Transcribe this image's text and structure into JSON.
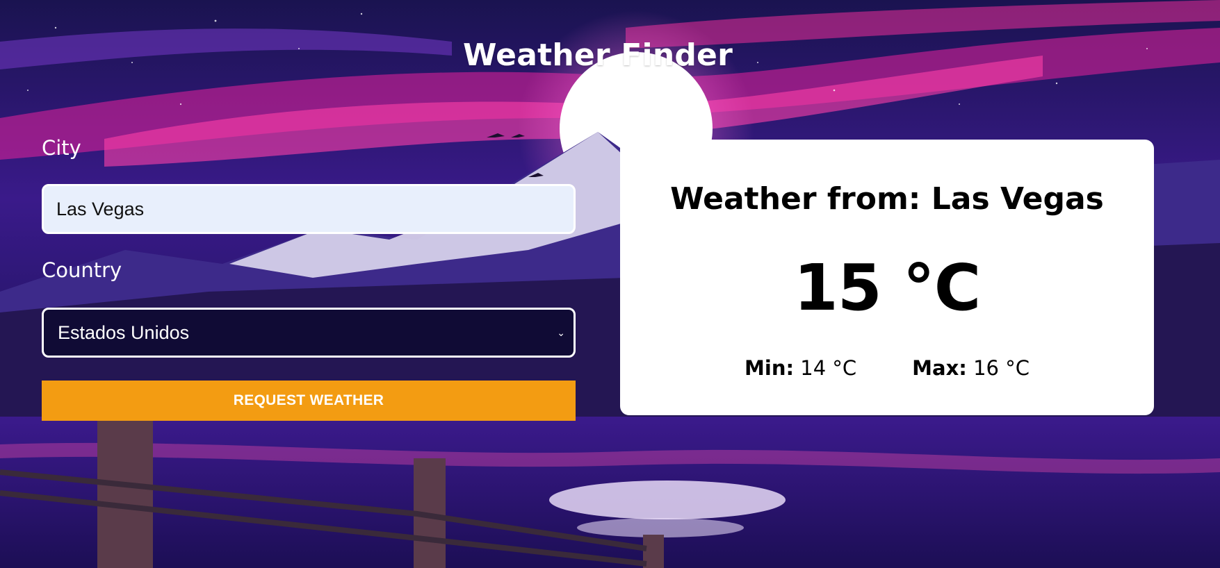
{
  "app": {
    "title": "Weather Finder"
  },
  "form": {
    "city_label": "City",
    "city_value": "Las Vegas",
    "country_label": "Country",
    "country_selected": "Estados Unidos",
    "submit_label": "REQUEST WEATHER"
  },
  "result": {
    "heading": "Weather from: Las Vegas",
    "temperature": "15 °C",
    "min_label": "Min:",
    "min_value": "14 °C",
    "max_label": "Max:",
    "max_value": "16 °C"
  },
  "colors": {
    "accent_button": "#f39c12",
    "input_background": "#e8effc",
    "card_background": "#ffffff",
    "text_light": "#ffffff",
    "text_dark": "#000000"
  },
  "icons": {
    "select_indicator": "chevron-down-icon"
  }
}
